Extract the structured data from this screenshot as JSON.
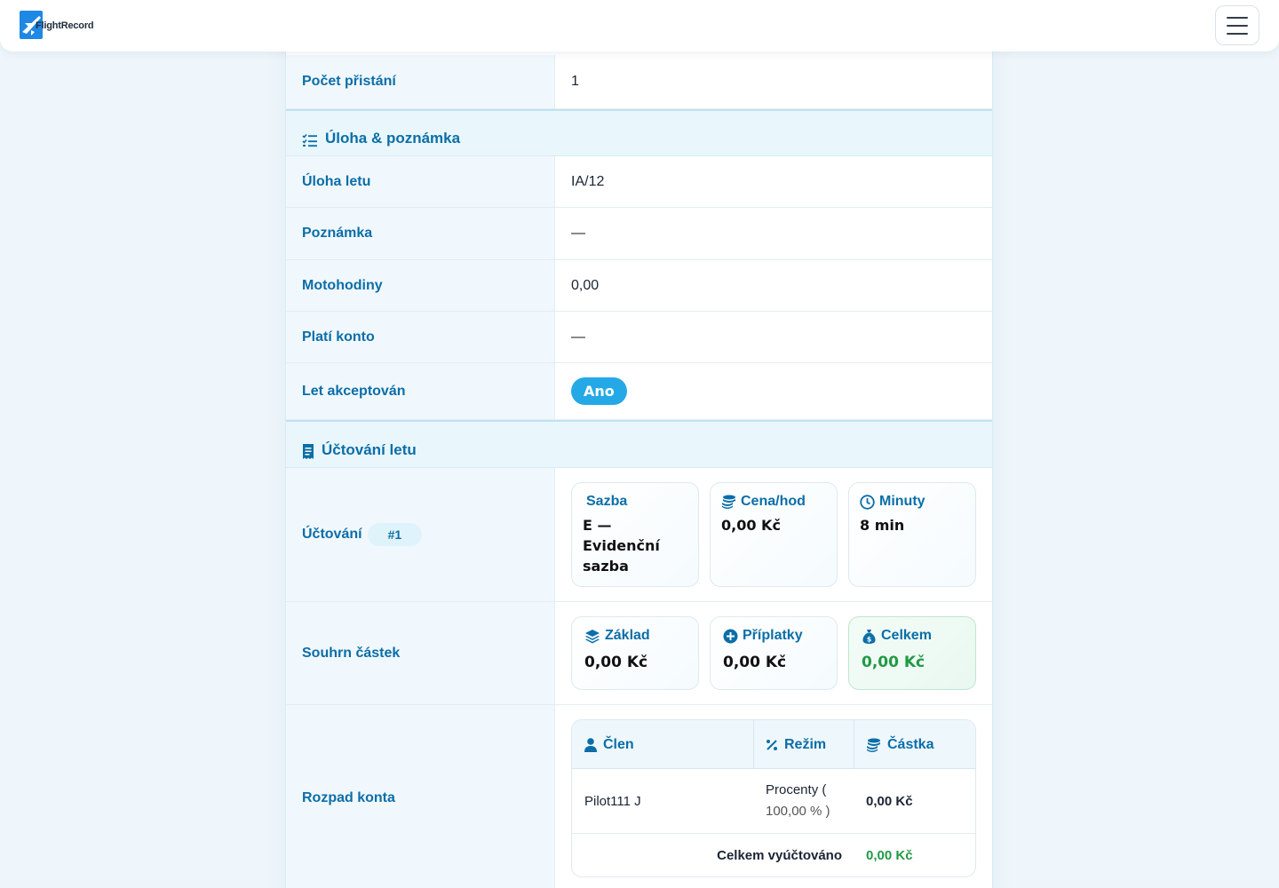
{
  "navbar": {
    "brand": "FlightRecord",
    "menu_icon": "hamburger-icon"
  },
  "rows": {
    "landings": {
      "label": "Počet přistání",
      "value": "1"
    },
    "task": {
      "label": "Úloha letu",
      "value": "IA/12"
    },
    "note": {
      "label": "Poznámka",
      "value": "—"
    },
    "engine_hours": {
      "label": "Motohodiny",
      "value": "0,00"
    },
    "paying_account": {
      "label": "Platí konto",
      "value": "—"
    },
    "accepted": {
      "label": "Let akceptován",
      "value": "Ano"
    }
  },
  "sections": {
    "task_note": {
      "title": "Úloha & poznámka",
      "icon": "list-check-icon"
    },
    "billing": {
      "title": "Účtování letu",
      "icon": "receipt-icon"
    }
  },
  "billing": {
    "label": "Účtování",
    "number": "#1",
    "rate": {
      "label": "Sazba",
      "value": "E — Evidenční sazba"
    },
    "price_per_hour": {
      "label": "Cena/hod",
      "value": "0,00 Kč",
      "icon": "coins-icon"
    },
    "minutes": {
      "label": "Minuty",
      "value": "8 min",
      "icon": "clock-icon"
    }
  },
  "summary": {
    "label": "Souhrn částek",
    "base": {
      "label": "Základ",
      "value": "0,00 Kč",
      "icon": "layers-icon"
    },
    "surcharges": {
      "label": "Příplatky",
      "value": "0,00 Kč",
      "icon": "plus-circle-icon"
    },
    "total": {
      "label": "Celkem",
      "value": "0,00 Kč",
      "icon": "money-bag-icon"
    }
  },
  "breakdown": {
    "label": "Rozpad konta",
    "headers": {
      "member": "Člen",
      "mode": "Režim",
      "amount": "Částka"
    },
    "rows": [
      {
        "member": "Pilot111 J",
        "mode_line1": "Procenty (",
        "mode_line2": "100,00 % )",
        "amount": "0,00 Kč"
      }
    ],
    "total_label": "Celkem vyúčtováno",
    "total_value": "0,00 Kč"
  },
  "colors": {
    "accent": "#0b6ea8",
    "badge": "#24a9e6",
    "success": "#219a45",
    "page_bg": "#eef6fb"
  }
}
